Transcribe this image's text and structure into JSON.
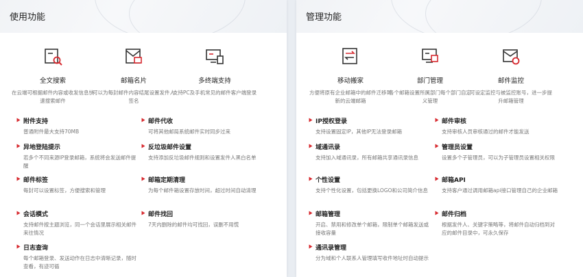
{
  "left": {
    "title": "使用功能",
    "features": [
      {
        "icon": "search-mail-icon",
        "title": "全文搜索",
        "desc": "在云端可根据邮件内容或收发信息快速搜索邮件"
      },
      {
        "icon": "mail-card-icon",
        "title": "邮箱名片",
        "desc": "可以为每封邮件内容结尾设置发件人签名"
      },
      {
        "icon": "multi-device-icon",
        "title": "多终端支持",
        "desc": "支持PC及手机常见的邮件客户端登录"
      }
    ],
    "items": [
      {
        "title": "附件支持",
        "desc": "普通附件最大支持70MB"
      },
      {
        "title": "邮件代收",
        "desc": "可将其他邮局系统邮件实时同步过来"
      },
      {
        "title": "异地登陆提示",
        "desc": "若多个不同来源IP登录邮箱，系统将会发送邮件提醒"
      },
      {
        "title": "反垃圾邮件设置",
        "desc": "支持添加反垃圾邮件规则和设置发件人黑白名单"
      },
      {
        "title": "邮件标签",
        "desc": "每封可以设置标签，方便搜索和管理"
      },
      {
        "title": "邮箱定期清理",
        "desc": "为每个邮件箱设置存放时间，超过时间自动清理"
      },
      {
        "title": "会话模式",
        "desc": "支持邮件按主题浏览，同一个会话里展示相关邮件来往情况"
      },
      {
        "title": "邮件找回",
        "desc": "7天内删除的邮件均可找回，误删不用慌"
      },
      {
        "title": "日志查询",
        "desc": "每个邮箱登录、发送动作在日志中清晰记录，随时查看，有迹可循"
      }
    ]
  },
  "right": {
    "title": "管理功能",
    "features": [
      {
        "icon": "migrate-icon",
        "title": "移动搬家",
        "desc": "方便将原有企业邮箱中的邮件迁移到新的云端邮箱"
      },
      {
        "icon": "department-icon",
        "title": "部门管理",
        "desc": "各个邮箱设置所属部门每个部门自定义管理"
      },
      {
        "icon": "mail-monitor-icon",
        "title": "邮件监控",
        "desc": "可设定监控与被监控账号，进一步提升邮箱管理"
      }
    ],
    "items": [
      {
        "title": "IP授权登录",
        "desc": "支持设置固定IP，其他IP无法登录邮箱"
      },
      {
        "title": "邮件审核",
        "desc": "支持审核人员审核通过的邮件才能发送"
      },
      {
        "title": "域通讯录",
        "desc": "支持加入域通讯录，所有邮箱共享通讯录信息"
      },
      {
        "title": "管理员设置",
        "desc": "设置多个子管理员，可以为子管理员设置相关权限"
      },
      {
        "title": "个性设置",
        "desc": "支持个性化设置，包括更换LOGO和公司简介信息"
      },
      {
        "title": "邮箱API",
        "desc": "支持客户通过调用邮箱api接口管理自己的企业邮箱"
      },
      {
        "title": "邮箱管理",
        "desc": "开启、禁用和修改单个邮箱，限制单个邮箱发送或接收容量"
      },
      {
        "title": "邮件归档",
        "desc": "根据发件人、关键字策略等，将邮件自动归档到对应的邮件目录中，可永久保存"
      },
      {
        "title": "通讯录管理",
        "desc": "分为域和个人联系人管理填写收件地址时自动提示"
      }
    ]
  },
  "colors": {
    "accent": "#d7282e",
    "icon_stroke": "#333333"
  }
}
